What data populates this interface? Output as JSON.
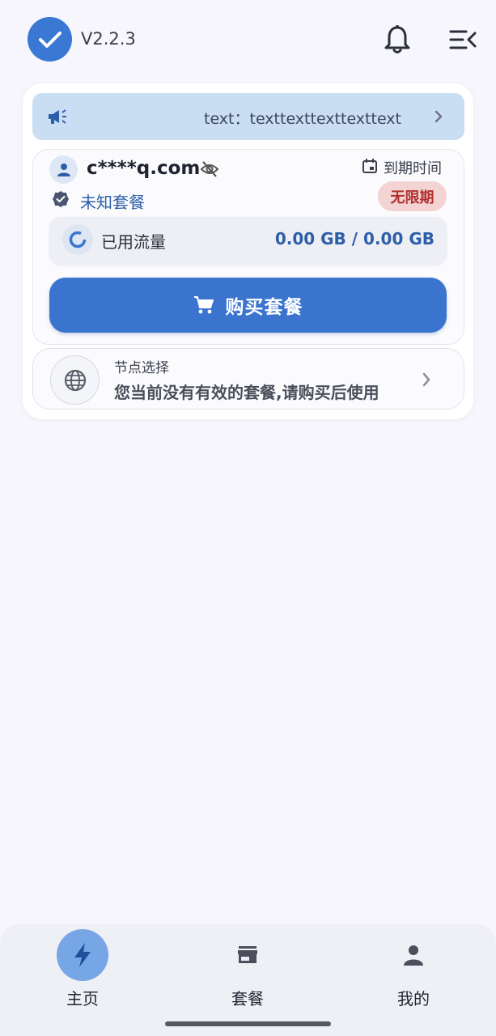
{
  "header": {
    "version": "V2.2.3",
    "icons": [
      "check-logo-icon",
      "bell-icon",
      "menu-collapse-icon"
    ]
  },
  "notice": {
    "text": "text：texttexttexttexttext",
    "icon": "megaphone-icon"
  },
  "account": {
    "email": "c****q.com",
    "expire_label": "到期时间",
    "plan_name": "未知套餐",
    "expire_badge": "无限期",
    "traffic_label": "已用流量",
    "traffic_value": "0.00 GB / 0.00 GB",
    "buy_button": "购买套餐"
  },
  "node": {
    "title": "节点选择",
    "description": "您当前没有有效的套餐,请购买后使用"
  },
  "bottom_nav": {
    "items": [
      {
        "label": "主页",
        "icon": "bolt-icon",
        "active": true
      },
      {
        "label": "套餐",
        "icon": "store-icon",
        "active": false
      },
      {
        "label": "我的",
        "icon": "person-icon",
        "active": false
      }
    ]
  },
  "colors": {
    "accent": "#3a74cf",
    "badge_bg": "#f4d3d3",
    "badge_text": "#b03030",
    "notice_bg": "#cadef3"
  }
}
